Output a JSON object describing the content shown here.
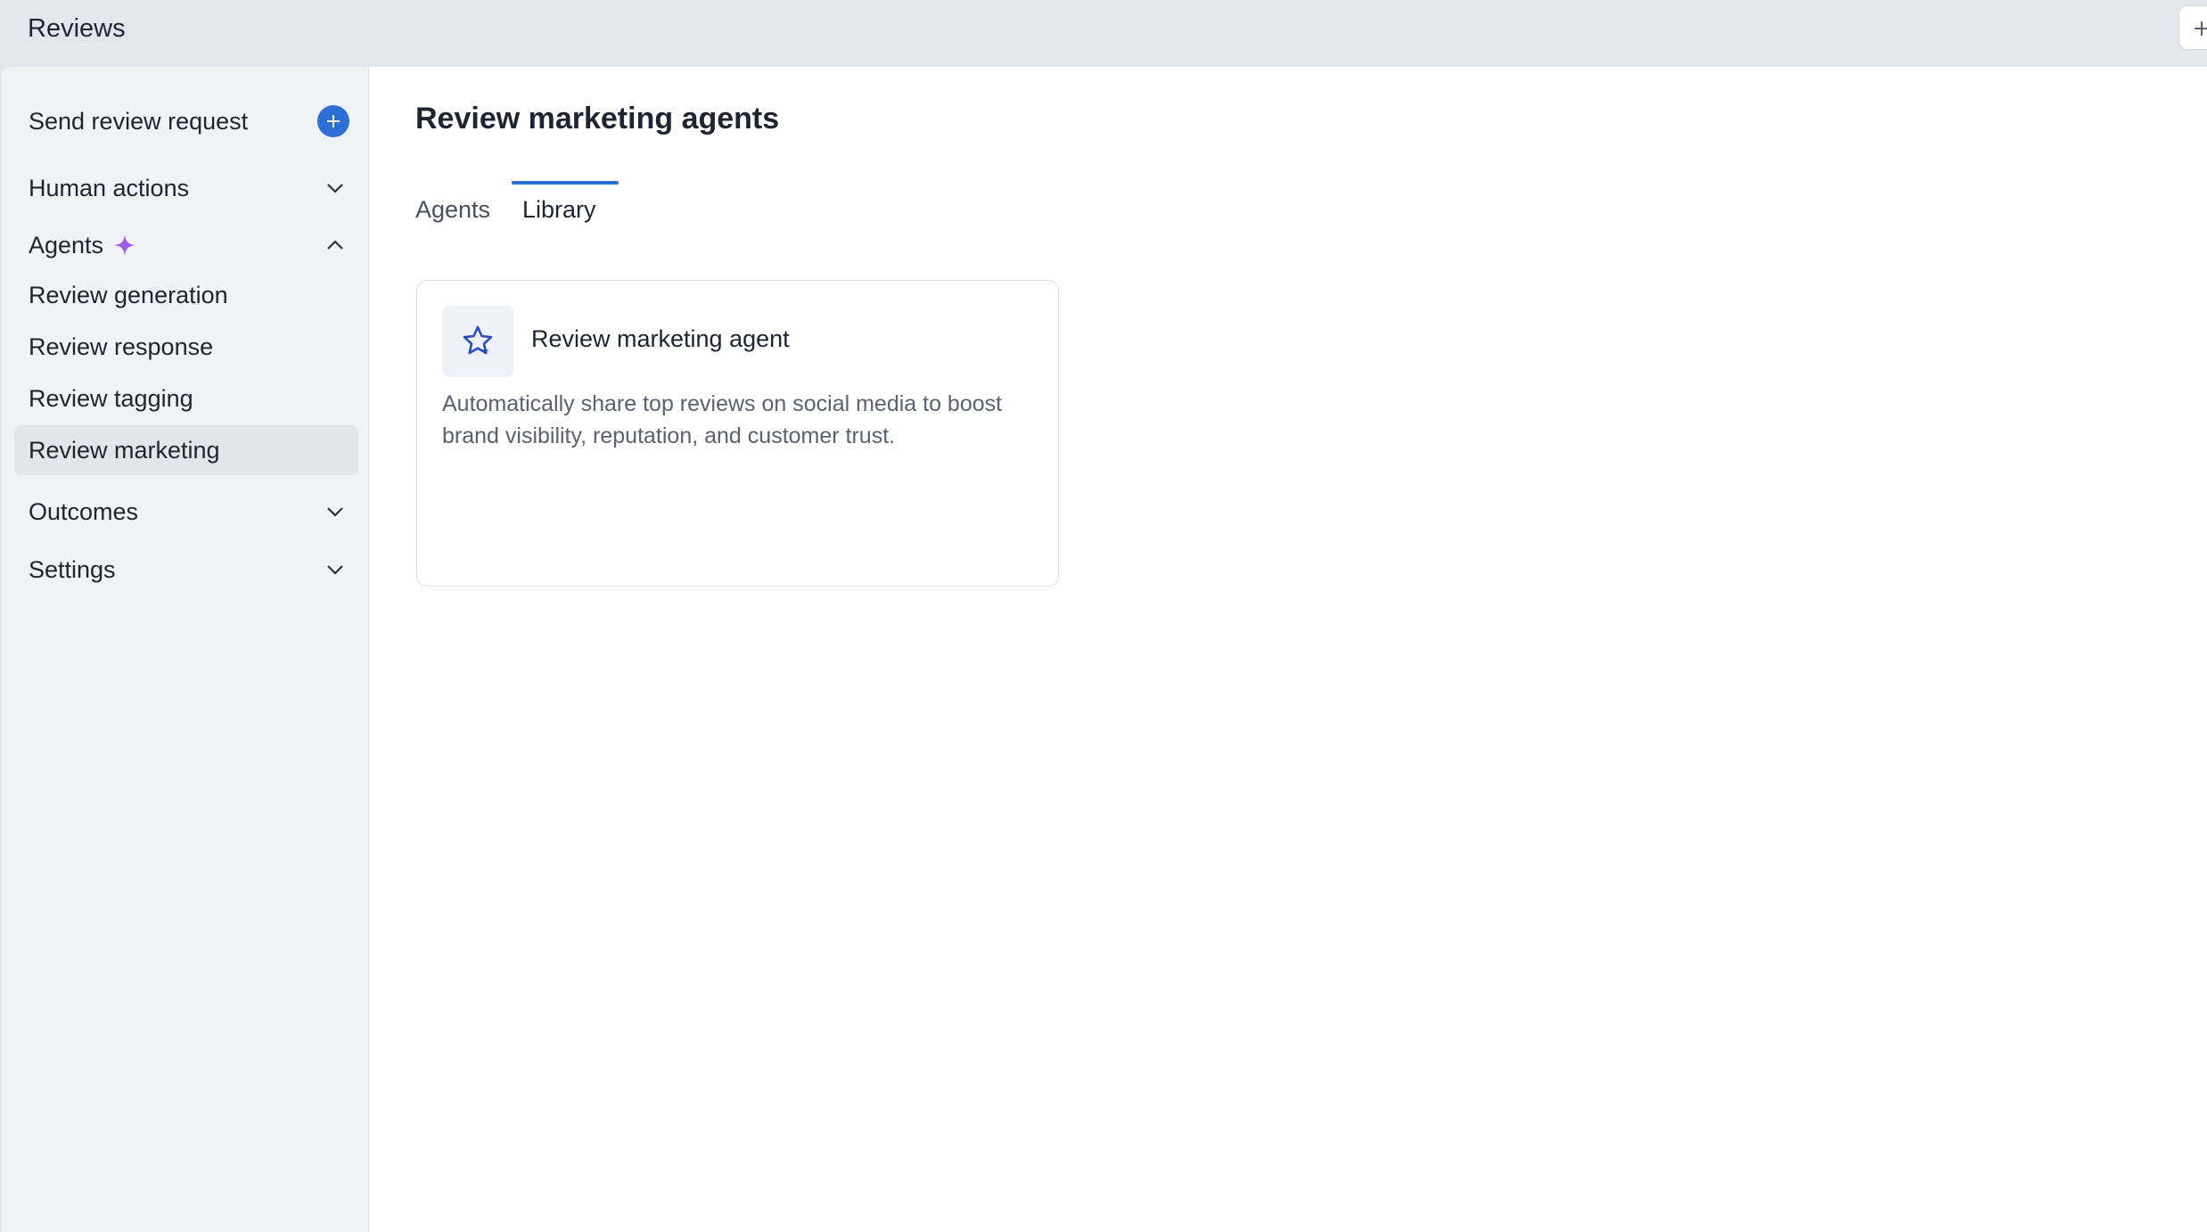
{
  "app": {
    "title": "Reviews"
  },
  "sidebar": {
    "send_request": {
      "label": "Send review request",
      "action_icon": "plus-circle-icon"
    },
    "groups": [
      {
        "label": "Human actions",
        "expanded": false
      },
      {
        "label": "Agents",
        "expanded": true,
        "badge_icon": "sparkle-icon",
        "items": [
          {
            "label": "Review generation",
            "selected": false
          },
          {
            "label": "Review response",
            "selected": false
          },
          {
            "label": "Review tagging",
            "selected": false
          },
          {
            "label": "Review marketing",
            "selected": true
          }
        ]
      },
      {
        "label": "Outcomes",
        "expanded": false
      },
      {
        "label": "Settings",
        "expanded": false
      }
    ]
  },
  "main": {
    "title": "Review marketing agents",
    "tabs": [
      {
        "label": "Agents",
        "active": false
      },
      {
        "label": "Library",
        "active": true
      }
    ],
    "cards": [
      {
        "icon": "star-sparkle-icon",
        "title": "Review marketing agent",
        "description": "Automatically share top reviews on social media to boost brand visibility, reputation, and customer trust."
      }
    ]
  },
  "colors": {
    "accent": "#2e6fd6",
    "sparkle": "#9b5de5",
    "sidebar_bg": "#f1f2f5",
    "selected_bg": "#e3e5ea",
    "topbar_bg": "#e3e6ec"
  }
}
